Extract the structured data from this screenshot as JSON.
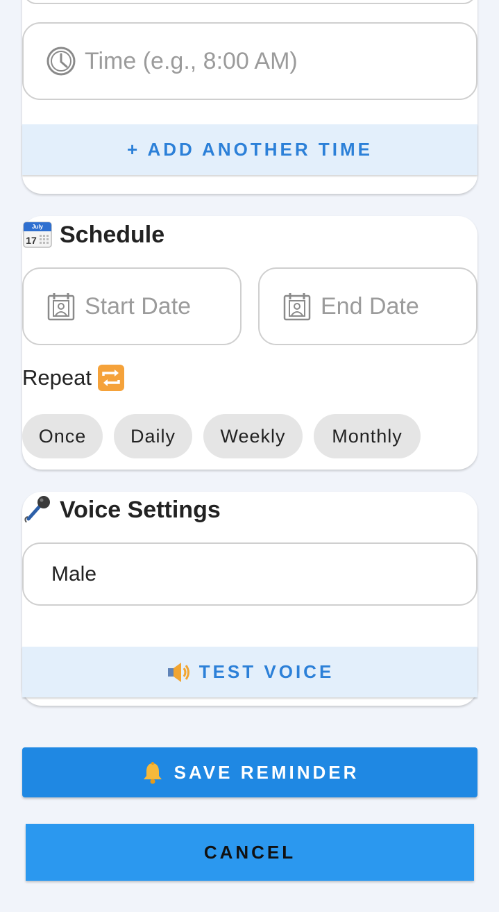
{
  "time_section": {
    "time_input": {
      "placeholder": "Time (e.g., 8:00 AM)",
      "icon": "clock-icon"
    },
    "add_time_button": {
      "label": "+ ADD ANOTHER TIME"
    }
  },
  "schedule": {
    "title": "Schedule",
    "icon": "calendar-icon",
    "start_date": {
      "placeholder": "Start Date",
      "icon": "calendar-person-icon"
    },
    "end_date": {
      "placeholder": "End Date",
      "icon": "calendar-person-icon"
    },
    "repeat_label": "Repeat",
    "repeat_icon": "repeat-icon",
    "repeat_options": [
      "Once",
      "Daily",
      "Weekly",
      "Monthly"
    ]
  },
  "voice": {
    "title": "Voice Settings",
    "icon": "microphone-icon",
    "selected_voice": "Male",
    "test_button": {
      "label": "TEST VOICE",
      "icon": "speaker-icon"
    }
  },
  "actions": {
    "save": {
      "label": "SAVE REMINDER",
      "icon": "bell-icon"
    },
    "cancel": {
      "label": "CANCEL"
    }
  },
  "colors": {
    "background": "#f1f4fa",
    "primary": "#1f88e3",
    "cancel": "#2b98ef",
    "accent_text": "#2c80d8",
    "light_button": "#e3effb",
    "chip": "#e5e5e5"
  }
}
